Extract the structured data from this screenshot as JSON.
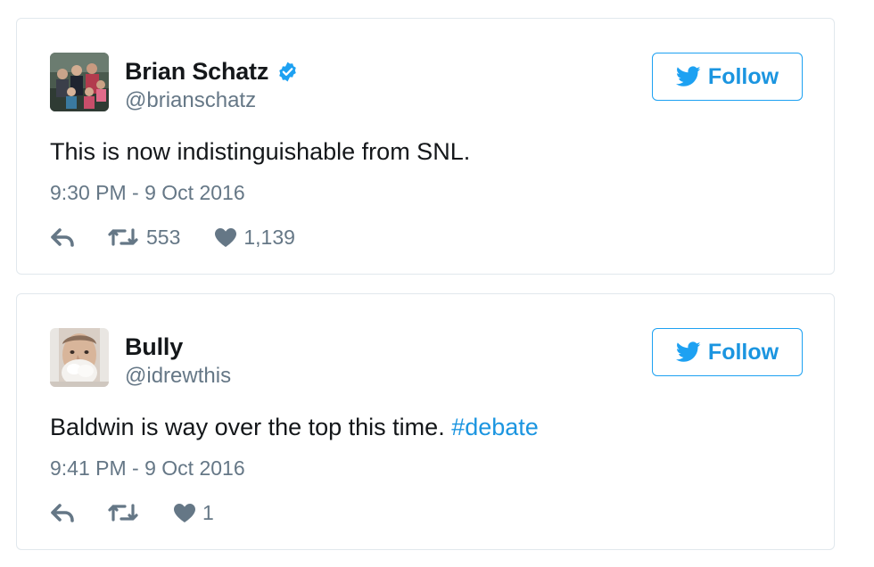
{
  "tweets": [
    {
      "display_name": "Brian Schatz",
      "verified": true,
      "handle": "@brianschatz",
      "follow_label": "Follow",
      "text": "This is now indistinguishable from SNL.",
      "hashtag": "",
      "timestamp": "9:30 PM - 9 Oct 2016",
      "retweets": "553",
      "likes": "1,139",
      "avatar": "family-photo-avatar"
    },
    {
      "display_name": "Bully",
      "verified": false,
      "handle": "@idrewthis",
      "follow_label": "Follow",
      "text": "Baldwin is way over the top this time. ",
      "hashtag": "#debate",
      "timestamp": "9:41 PM - 9 Oct 2016",
      "retweets": "",
      "likes": "1",
      "avatar": "man-with-shaving-cream-avatar"
    }
  ],
  "colors": {
    "accent": "#1da1f2",
    "link": "#1b95e0",
    "text": "#14171a",
    "muted": "#657786",
    "border": "#e1e8ed"
  },
  "icons": {
    "verified": "verified-badge-icon",
    "follow": "twitter-bird-icon",
    "reply": "reply-icon",
    "retweet": "retweet-icon",
    "like": "heart-icon"
  }
}
